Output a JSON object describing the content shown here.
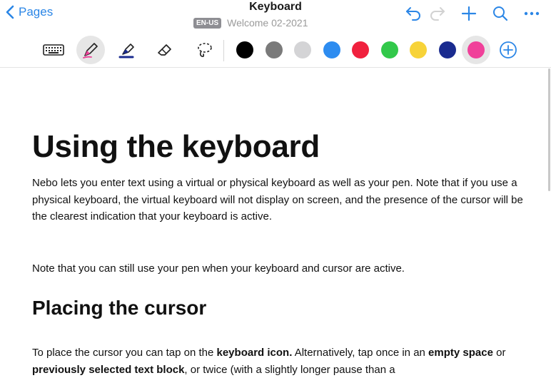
{
  "nav": {
    "back_label": "Pages"
  },
  "header": {
    "title": "Keyboard",
    "lang_badge": "EN-US",
    "subtitle": "Welcome 02-2021"
  },
  "actions": [
    "undo-icon",
    "redo-icon",
    "plus-icon",
    "search-icon",
    "more-icon"
  ],
  "tools": [
    {
      "name": "keyboard-icon",
      "active": false
    },
    {
      "name": "pen-icon",
      "active": true
    },
    {
      "name": "highlighter-icon",
      "active": false
    },
    {
      "name": "eraser-icon",
      "active": false
    },
    {
      "name": "lasso-icon",
      "active": false
    }
  ],
  "colors": [
    "#000000",
    "#7a7a7a",
    "#d4d4d6",
    "#2d8cf0",
    "#f0213e",
    "#32c84a",
    "#f7d339",
    "#1a2b8f",
    "#f0419a"
  ],
  "selected_color": "#f0419a",
  "accent": "#2b86e6",
  "document": {
    "h1": "Using the keyboard",
    "p1": "Nebo lets you enter text using a virtual or physical keyboard as well as your pen. Note that if you use a physical keyboard, the virtual keyboard will not display on screen, and the presence of the cursor will be the clearest indication that your keyboard is active.",
    "p2": "Note that you can still use your pen when your keyboard and cursor are active.",
    "h2": "Placing the cursor",
    "p3": {
      "t1": "To place the cursor you can tap on the ",
      "b1": "keyboard icon.",
      "t2": " Alternatively, tap once in an ",
      "b2": "empty space",
      "t3": " or ",
      "b3": "previously selected text block",
      "t4": ", or twice (with a slightly longer pause than a"
    }
  }
}
